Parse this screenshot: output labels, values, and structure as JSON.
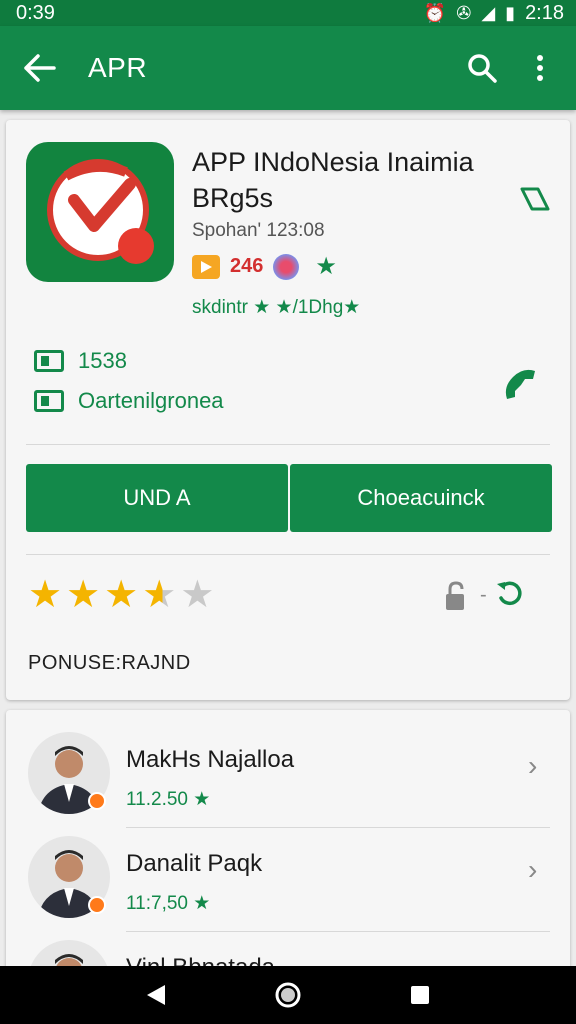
{
  "status_bar": {
    "time_left": "0:39",
    "time_right": "2:18"
  },
  "app_bar": {
    "title": "APR"
  },
  "app": {
    "name": "APP INdoNesia Inaimia BRg5s",
    "sub": "Spohan' 123:08",
    "badge_count": "246",
    "rating_text": "skdintr ★ ★/1Dhg★"
  },
  "info": {
    "row1": "1538",
    "row2": "Oartenilgronea"
  },
  "buttons": {
    "left": "UND A",
    "right": "Choeacuinck"
  },
  "rating": {
    "stars": 3.6,
    "max": 5
  },
  "section_label": "PONUSE:RAJND",
  "people": [
    {
      "name": "MakHs Najalloa",
      "meta": "11.2.50 ★"
    },
    {
      "name": "Danalit Paqk",
      "meta": "11:7,50 ★"
    },
    {
      "name": "Vinl Bbnatada",
      "meta": ""
    }
  ],
  "colors": {
    "primary": "#13894a",
    "status": "#0f7b3e",
    "star": "#f4b400"
  }
}
